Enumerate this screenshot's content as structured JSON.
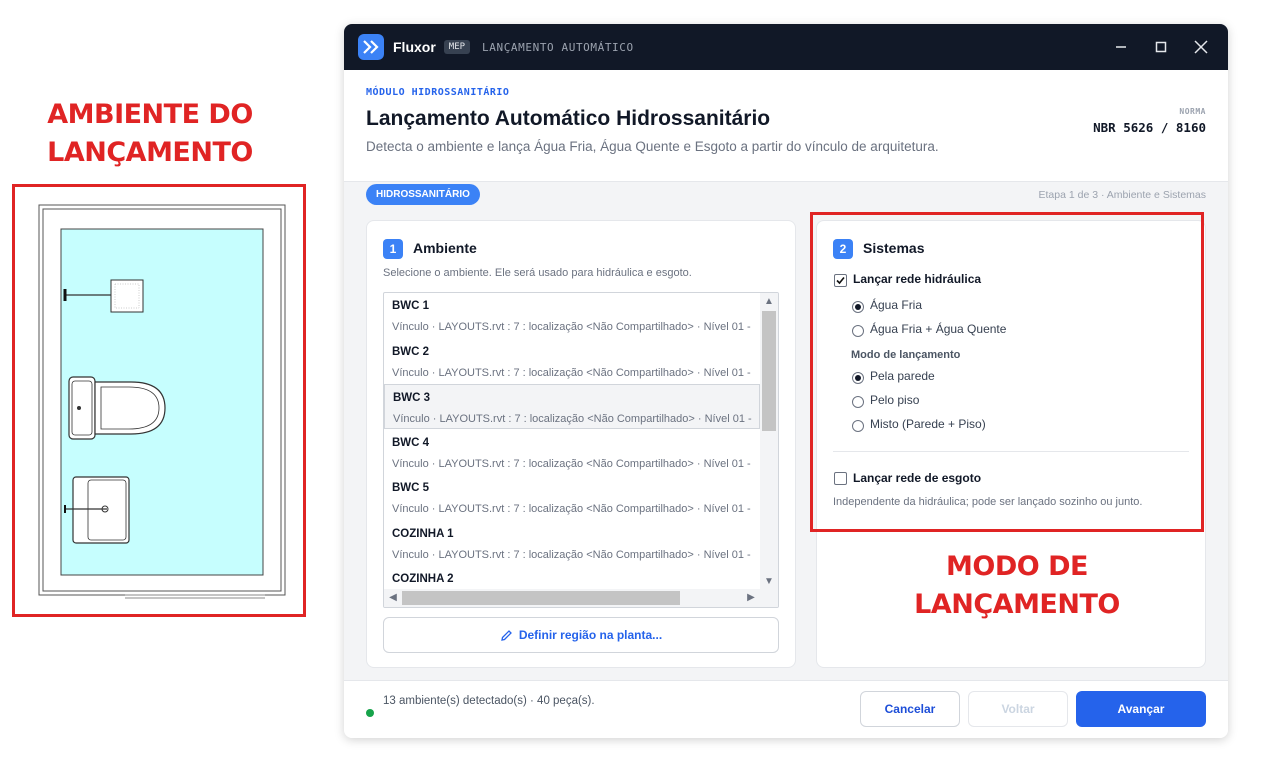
{
  "annotations": {
    "left_line1": "AMBIENTE DO",
    "left_line2": "LANÇAMENTO",
    "right_line1": "MODO DE",
    "right_line2": "LANÇAMENTO",
    "highlight_color": "#e02424"
  },
  "window": {
    "app_name": "Fluxor",
    "badge": "MEP",
    "subtitle": "LANÇAMENTO AUTOMÁTICO",
    "controls": [
      "minimize-icon",
      "maximize-icon",
      "close-icon"
    ]
  },
  "header": {
    "module": "MÓDULO HIDROSSANITÁRIO",
    "title": "Lançamento Automático Hidrossanitário",
    "description": "Detecta o ambiente e lança Água Fria, Água Quente e Esgoto a partir do vínculo de arquitetura.",
    "norma_label": "NORMA",
    "norma_value": "NBR 5626 / 8160"
  },
  "toolbar": {
    "tag": "HIDROSSANITÁRIO",
    "step": "Etapa 1 de 3 · Ambiente e Sistemas"
  },
  "ambiente": {
    "number": "1",
    "title": "Ambiente",
    "hint": "Selecione o ambiente. Ele será usado para hidráulica e esgoto.",
    "items": [
      {
        "name": "BWC 1",
        "sub": "Vínculo · LAYOUTS.rvt : 7 : localização <Não Compartilhado>  · Nível  01 -"
      },
      {
        "name": "BWC 2",
        "sub": "Vínculo · LAYOUTS.rvt : 7 : localização <Não Compartilhado>  · Nível  01 -"
      },
      {
        "name": "BWC 3",
        "sub": "Vínculo · LAYOUTS.rvt : 7 : localização <Não Compartilhado>  · Nível  01 -"
      },
      {
        "name": "BWC 4",
        "sub": "Vínculo · LAYOUTS.rvt : 7 : localização <Não Compartilhado>  · Nível  01 -"
      },
      {
        "name": "BWC 5",
        "sub": "Vínculo · LAYOUTS.rvt : 7 : localização <Não Compartilhado>  · Nível  01 -"
      },
      {
        "name": "COZINHA 1",
        "sub": "Vínculo · LAYOUTS.rvt : 7 : localização <Não Compartilhado>  · Nível  01 -"
      },
      {
        "name": "COZINHA 2",
        "sub": ""
      }
    ],
    "selected_index": 2,
    "define_button": "Definir região na planta..."
  },
  "sistemas": {
    "number": "2",
    "title": "Sistemas",
    "hidraulica_label": "Lançar rede hidráulica",
    "hidraulica_checked": true,
    "agua_options": [
      "Água Fria",
      "Água Fria + Água Quente"
    ],
    "agua_selected": 0,
    "modo_label": "Modo de lançamento",
    "modo_options": [
      "Pela parede",
      "Pelo piso",
      "Misto (Parede + Piso)"
    ],
    "modo_selected": 0,
    "esgoto_label": "Lançar rede de esgoto",
    "esgoto_checked": false,
    "esgoto_hint": "Independente da hidráulica; pode ser lançado sozinho ou junto."
  },
  "footer": {
    "status": "13 ambiente(s) detectado(s) · 40 peça(s).",
    "status_color": "#16a34a",
    "cancel": "Cancelar",
    "back": "Voltar",
    "next": "Avançar"
  },
  "colors": {
    "accent": "#3b82f6",
    "titlebar": "#111827",
    "room_fill": "#c6fefe"
  }
}
